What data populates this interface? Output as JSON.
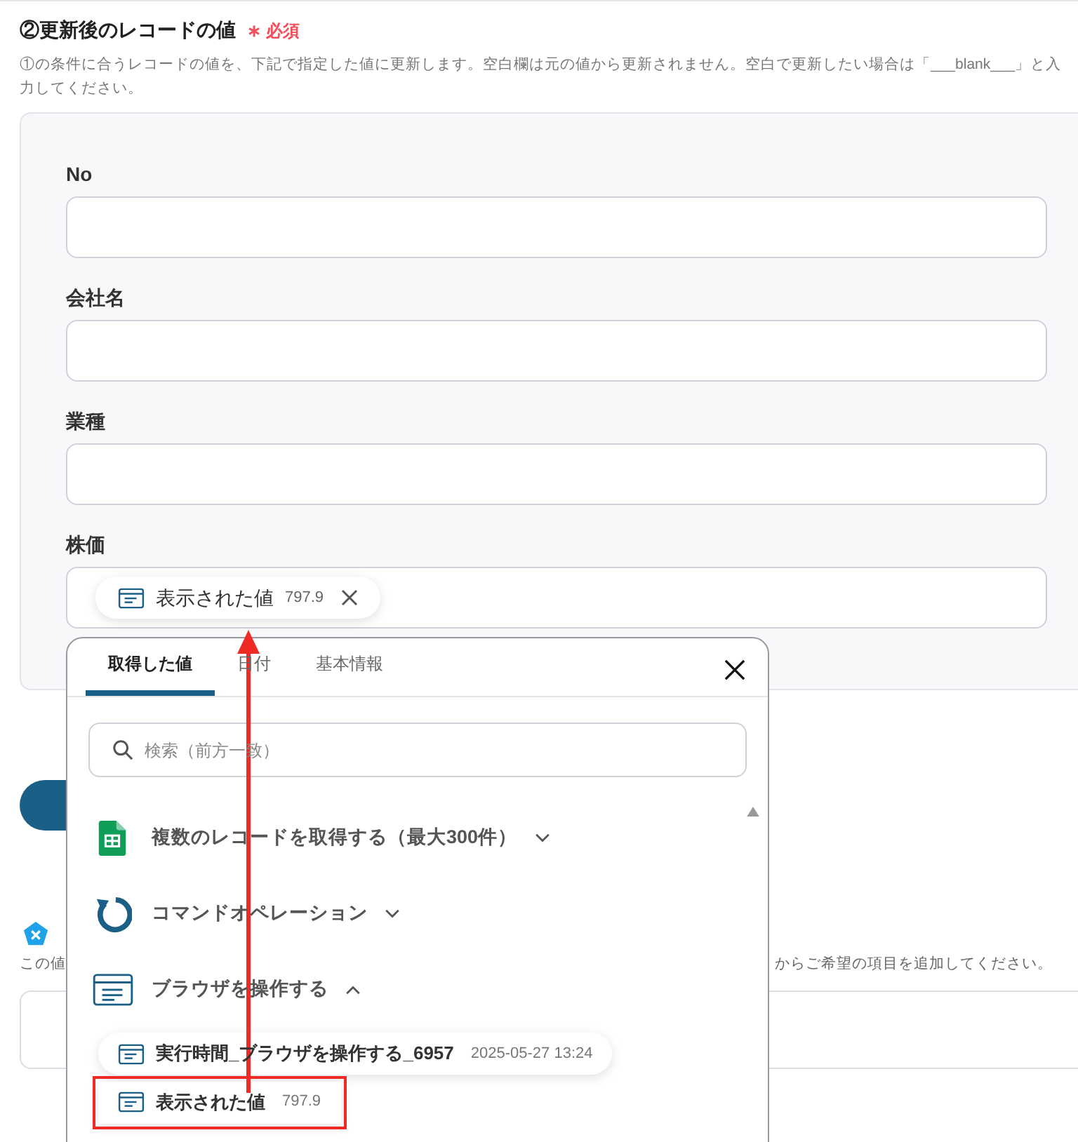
{
  "section": {
    "title": "②更新後のレコードの値",
    "required_mark": "∗",
    "required": "必須",
    "description": "①の条件に合うレコードの値を、下記で指定した値に更新します。空白欄は元の値から更新されません。空白で更新したい場合は「___blank___」と入力してください。"
  },
  "fields": [
    {
      "label": "No"
    },
    {
      "label": "会社名"
    },
    {
      "label": "業種"
    },
    {
      "label": "株価",
      "chip": {
        "label": "表示された値",
        "value": "797.9"
      }
    }
  ],
  "next_section": {
    "description_start": "この値",
    "description_end": "からご希望の項目を追加してください。"
  },
  "popup": {
    "tabs": [
      {
        "label": "取得した値",
        "selected": true
      },
      {
        "label": "日付",
        "selected": false
      },
      {
        "label": "基本情報",
        "selected": false
      }
    ],
    "search": {
      "placeholder": "検索（前方一致）"
    },
    "groups": [
      {
        "label": "複数のレコードを取得する（最大300件）",
        "kind": "sheet",
        "expanded": false
      },
      {
        "label": "コマンドオペレーション",
        "kind": "command",
        "expanded": false
      },
      {
        "label": "ブラウザを操作する",
        "kind": "browser",
        "expanded": true,
        "children": [
          {
            "label": "実行時間_ブラウザを操作する_6957",
            "value": "2025-05-27 13:24",
            "highlighted": false
          },
          {
            "label": "表示された値",
            "value": "797.9",
            "highlighted": true
          }
        ]
      }
    ]
  }
}
